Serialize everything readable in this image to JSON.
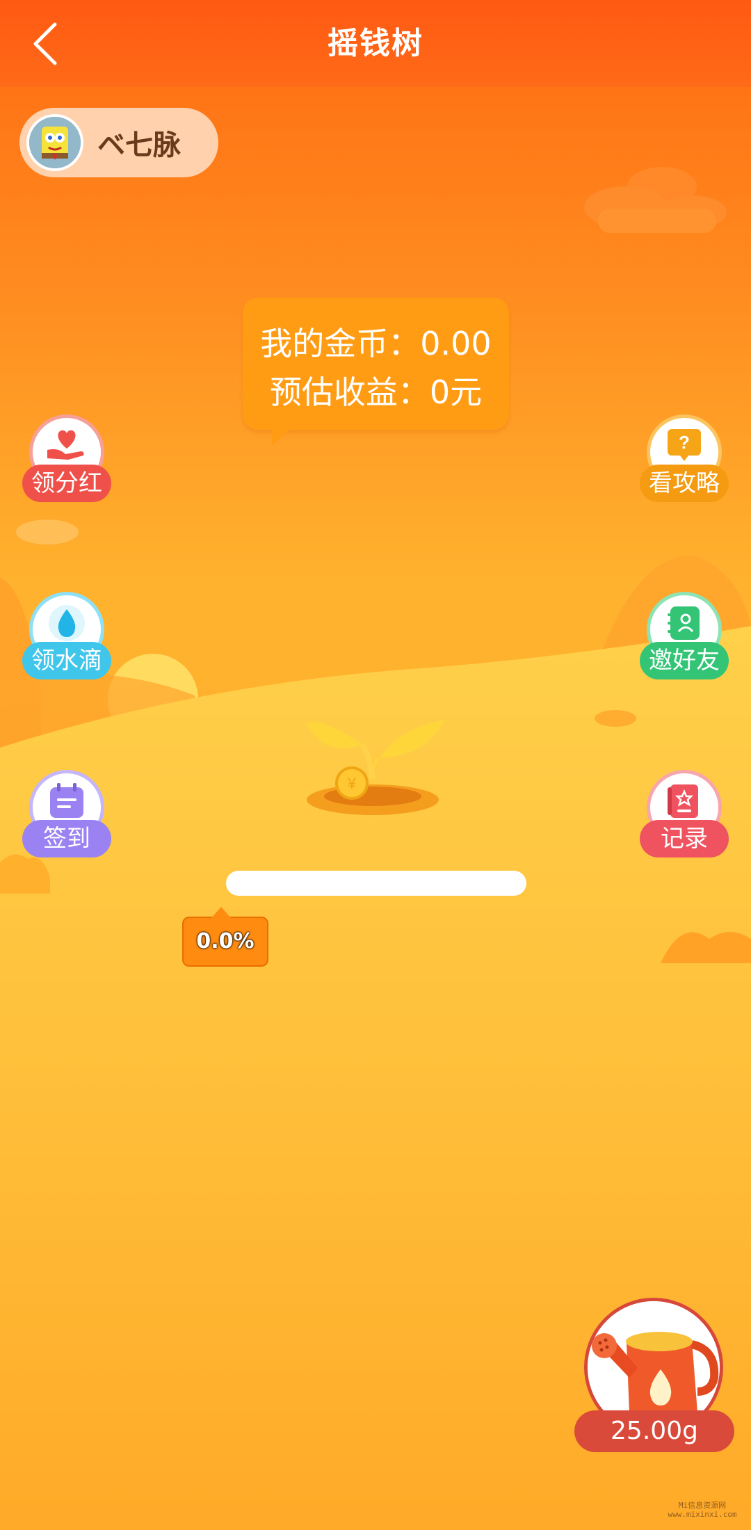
{
  "header": {
    "title": "摇钱树"
  },
  "user": {
    "name": "ベ七脉"
  },
  "bubble": {
    "coins_line": "我的金币：0.00",
    "income_line": "预估收益：0元"
  },
  "left_actions": [
    {
      "label": "领分红",
      "icon": "heart-hand-icon",
      "color": "#f0504a"
    },
    {
      "label": "领水滴",
      "icon": "water-drop-icon",
      "color": "#3fc6ea"
    },
    {
      "label": "签到",
      "icon": "calendar-icon",
      "color": "#9a82f2"
    }
  ],
  "right_actions": [
    {
      "label": "看攻略",
      "icon": "question-icon",
      "color": "#f59b12"
    },
    {
      "label": "邀好友",
      "icon": "contacts-icon",
      "color": "#33c476"
    },
    {
      "label": "记录",
      "icon": "record-icon",
      "color": "#ef5360"
    }
  ],
  "progress": {
    "label": "0.0%",
    "value": 0.0
  },
  "watering": {
    "amount": "25.00g"
  },
  "watermark": {
    "line1": "Mi信息资源网",
    "line2": "www.mixinxi.com"
  }
}
